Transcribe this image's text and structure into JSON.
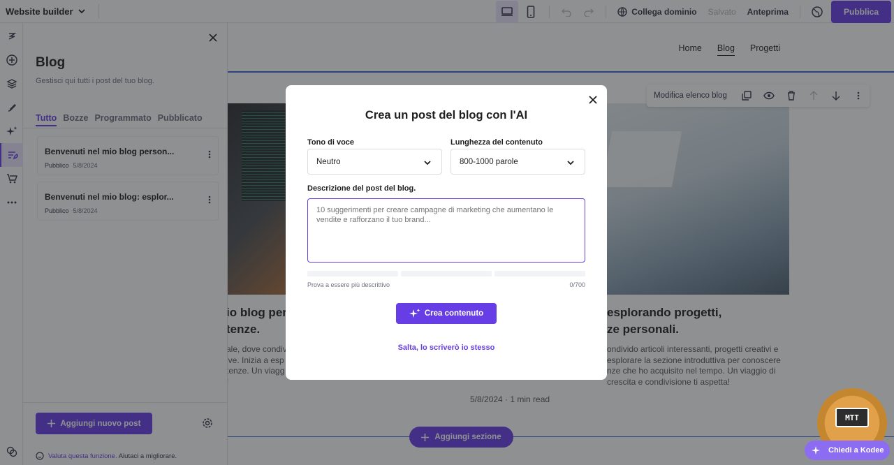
{
  "topbar": {
    "app_name": "Website builder",
    "connect_domain": "Collega dominio",
    "saved": "Salvato",
    "preview": "Anteprima",
    "publish": "Pubblica"
  },
  "panel": {
    "title": "Blog",
    "subtitle": "Gestisci qui tutti i post del tuo blog.",
    "tabs": [
      {
        "label": "Tutto",
        "active": true
      },
      {
        "label": "Bozze",
        "active": false
      },
      {
        "label": "Programmato",
        "active": false
      },
      {
        "label": "Pubblicato",
        "active": false
      }
    ],
    "posts": [
      {
        "title": "Benvenuti nel mio blog person...",
        "status": "Pubblico",
        "date": "5/8/2024"
      },
      {
        "title": "Benvenuti nel mio blog: esplor...",
        "status": "Pubblico",
        "date": "5/8/2024"
      }
    ],
    "add_post": "Aggiungi nuovo post",
    "feedback_link": "Valuta questa funzione.",
    "feedback_text": "Aiutaci a migliorare."
  },
  "canvas": {
    "nav": [
      "Home",
      "Blog",
      "Progetti"
    ],
    "section_toolbar_label": "Modifica elenco blog",
    "card_left": {
      "title_line1": "io blog per",
      "title_line2": "tenze.",
      "text_lines": [
        "ale, dove condiv",
        "ive. Inizia a esp",
        "tenze. Un viagg",
        "!"
      ]
    },
    "card_right": {
      "title_line1": "esplorando progetti,",
      "title_line2": "ze personali.",
      "text_lines": [
        "ondivido articoli interessanti, progetti creativi e",
        "esplorare la sezione introduttiva per conoscere",
        "nze che ho acquisito nel tempo. Un viaggio di",
        "crescita e condivisione ti aspetta!"
      ],
      "date": "5/8/2024 · 1 min read"
    },
    "add_section": "Aggiungi sezione"
  },
  "modal": {
    "title": "Crea un post del blog con l'AI",
    "tone_label": "Tono di voce",
    "tone_value": "Neutro",
    "length_label": "Lunghezza del contenuto",
    "length_value": "800-1000 parole",
    "description_label": "Descrizione del post del blog.",
    "description_placeholder": "10 suggerimenti per creare campagne di marketing che aumentano le vendite e rafforzano il tuo brand...",
    "hint": "Prova a essere più descrittivo",
    "counter": "0/700",
    "create_button": "Crea contenuto",
    "skip_link": "Salta, lo scriverò io stesso"
  },
  "floating": {
    "kodee": "Chiedi a Kodee",
    "badge": "MTT"
  },
  "colors": {
    "accent": "#673de6"
  }
}
